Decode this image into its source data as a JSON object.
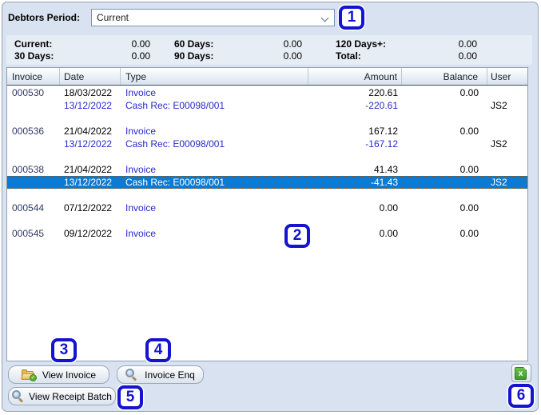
{
  "colors": {
    "window_bg": "#d8e2f0",
    "summary_bg": "#e7edf5",
    "selected_row_bg": "#0d7ad1",
    "link_blue": "#2929cc",
    "invoice_number_navy": "#333a66",
    "badge_blue": "#1414d0",
    "header_border_dark": "#3c4c60"
  },
  "toolbar": {
    "label": "Debtors Period:",
    "period_value": "Current"
  },
  "summary": {
    "items": [
      {
        "label": "Current:",
        "value": "0.00"
      },
      {
        "label": "60 Days:",
        "value": "0.00"
      },
      {
        "label": "120 Days+:",
        "value": "0.00"
      },
      {
        "label": "30 Days:",
        "value": "0.00"
      },
      {
        "label": "90 Days:",
        "value": "0.00"
      },
      {
        "label": "Total:",
        "value": "0.00"
      }
    ]
  },
  "table": {
    "columns": [
      "Invoice",
      "Date",
      "Type",
      "Amount",
      "Balance",
      "User"
    ],
    "rows": [
      {
        "kind": "invoice",
        "invoice": "000530",
        "date": "18/03/2022",
        "type": "Invoice",
        "amount": "220.61",
        "balance": "0.00",
        "user": ""
      },
      {
        "kind": "cashrec",
        "invoice": "",
        "date": "13/12/2022",
        "type": "Cash Rec: E00098/001",
        "amount": "-220.61",
        "balance": "",
        "user": "JS2"
      },
      {
        "kind": "spacer"
      },
      {
        "kind": "invoice",
        "invoice": "000536",
        "date": "21/04/2022",
        "type": "Invoice",
        "amount": "167.12",
        "balance": "0.00",
        "user": ""
      },
      {
        "kind": "cashrec",
        "invoice": "",
        "date": "13/12/2022",
        "type": "Cash Rec: E00098/001",
        "amount": "-167.12",
        "balance": "",
        "user": "JS2"
      },
      {
        "kind": "spacer"
      },
      {
        "kind": "invoice",
        "invoice": "000538",
        "date": "21/04/2022",
        "type": "Invoice",
        "amount": "41.43",
        "balance": "0.00",
        "user": ""
      },
      {
        "kind": "cashrec",
        "invoice": "",
        "date": "13/12/2022",
        "type": "Cash Rec: E00098/001",
        "amount": "-41.43",
        "balance": "",
        "user": "JS2",
        "selected": true
      },
      {
        "kind": "spacer"
      },
      {
        "kind": "invoice",
        "invoice": "000544",
        "date": "07/12/2022",
        "type": "Invoice",
        "amount": "0.00",
        "balance": "0.00",
        "user": ""
      },
      {
        "kind": "spacer"
      },
      {
        "kind": "invoice",
        "invoice": "000545",
        "date": "09/12/2022",
        "type": "Invoice",
        "amount": "0.00",
        "balance": "0.00",
        "user": ""
      }
    ]
  },
  "buttons": {
    "view_invoice": "View Invoice",
    "invoice_enq": "Invoice Enq",
    "view_receipt_batch": "View Receipt Batch"
  },
  "icons": {
    "dropdown": "chevron-down-icon",
    "view_invoice": "open-folder-check-icon",
    "invoice_enq": "magnifier-icon",
    "view_receipt_batch": "magnifier-icon",
    "export": "excel-export-icon",
    "folder_check_glyph": "✓",
    "excel_letter": "x"
  },
  "annotations": {
    "badges": [
      "1",
      "2",
      "3",
      "4",
      "5",
      "6"
    ]
  }
}
